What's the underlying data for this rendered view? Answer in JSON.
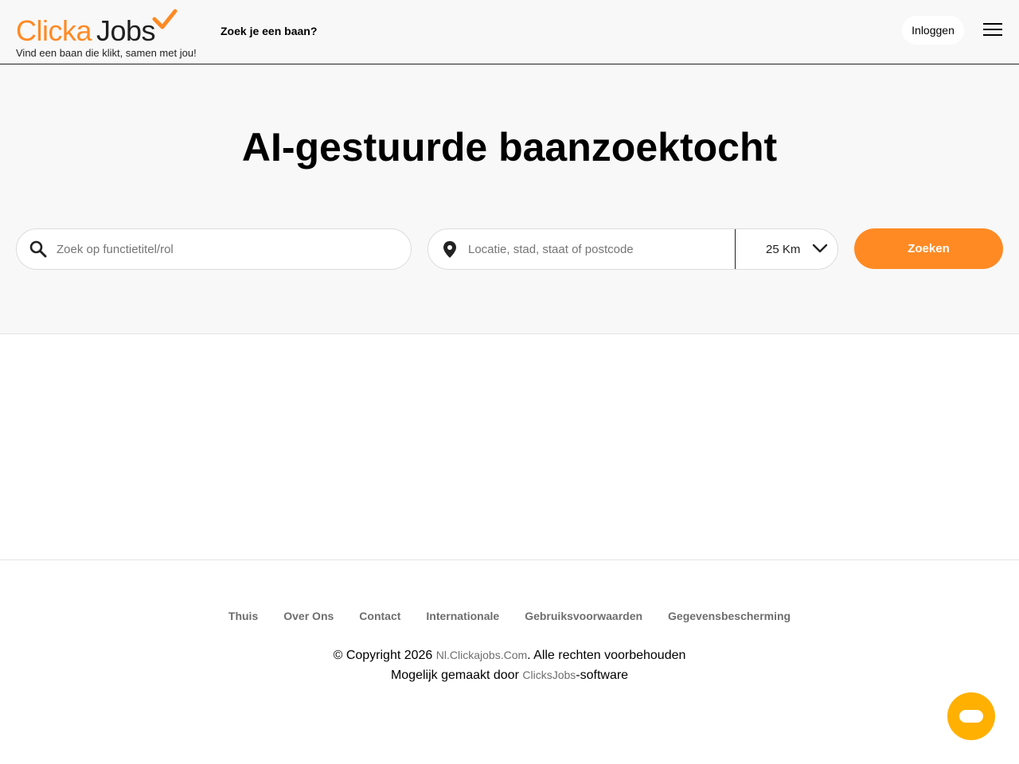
{
  "header": {
    "logo_part1": "Clicka",
    "logo_part2": "Jobs",
    "tagline": "Vind een baan die klikt, samen met jou!",
    "nav_link": "Zoek je een baan?",
    "login_label": "Inloggen",
    "menu_icon": "hamburger-icon"
  },
  "hero": {
    "title": "AI-gestuurde baanzoektocht",
    "job_search": {
      "placeholder": "Zoek op functietitel/rol",
      "icon": "search-icon"
    },
    "location_search": {
      "placeholder": "Locatie, stad, staat of postcode",
      "icon": "location-pin-icon"
    },
    "radius": {
      "selected": "25 Km",
      "icon": "chevron-down-icon"
    },
    "search_button_label": "Zoeken"
  },
  "footer": {
    "links": [
      "Thuis",
      "Over Ons",
      "Contact",
      "Internationale",
      "Gebruiksvoorwaarden",
      "Gegevensbescherming"
    ],
    "copyright_prefix": "© Copyright 2026 ",
    "site_link": "Nl.Clickajobs.Com",
    "copyright_suffix": ". Alle rechten voorbehouden",
    "powered_prefix": "Mogelijk gemaakt door ",
    "powered_link": "ClicksJobs",
    "powered_suffix": "-software"
  },
  "colors": {
    "brand_orange": "#ff8a24",
    "chat_yellow": "#ffb000",
    "hero_bg": "#f8f8f8"
  },
  "chat": {
    "icon": "chat-icon"
  }
}
